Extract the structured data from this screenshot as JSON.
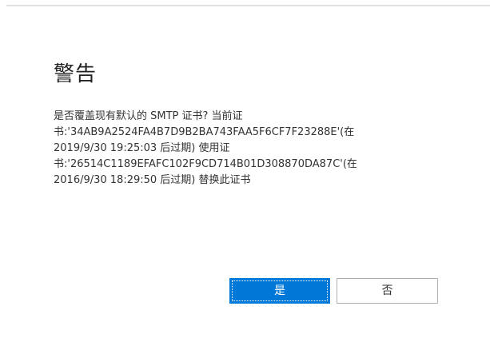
{
  "dialog": {
    "title": "警告",
    "message_lines": [
      "是否覆盖现有默认的 SMTP 证书? 当前证",
      "书:'34AB9A2524FA4B7D9B2BA743FAA5F6CF7F23288E'(在",
      "2019/9/30 19:25:03 后过期) 使用证",
      "书:'26514C1189EFAFC102F9CD714B01D308870DA87C'(在",
      "2016/9/30 18:29:50 后过期) 替换此证书"
    ],
    "yes_label": "是",
    "no_label": "否"
  },
  "colors": {
    "primary_button": "#0078d7",
    "secondary_border": "#b0b0b0"
  }
}
